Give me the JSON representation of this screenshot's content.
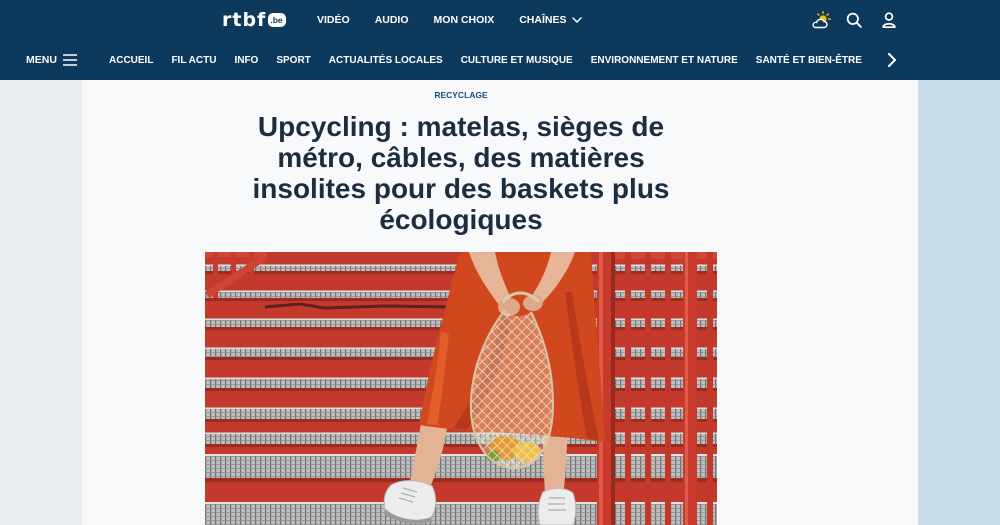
{
  "header": {
    "logo": {
      "text": "rtbf",
      "suffix": ".be"
    },
    "top_nav": [
      {
        "label": "VIDÉO"
      },
      {
        "label": "AUDIO"
      },
      {
        "label": "MON CHOIX"
      },
      {
        "label": "CHAÎNES",
        "icon": "chevron-down-icon"
      }
    ],
    "actions": [
      {
        "icon": "weather-icon"
      },
      {
        "icon": "search-icon"
      },
      {
        "icon": "user-icon"
      }
    ],
    "menu": {
      "label": "MENU",
      "icon": "hamburger-icon"
    },
    "section_nav": [
      "ACCUEIL",
      "FIL ACTU",
      "INFO",
      "SPORT",
      "ACTUALITÉS LOCALES",
      "CULTURE ET MUSIQUE",
      "ENVIRONNEMENT ET NATURE",
      "SANTÉ ET BIEN-ÊTRE"
    ],
    "section_nav_next_icon": "chevron-right-icon"
  },
  "article": {
    "category": "RECYCLAGE",
    "title": "Upcycling : matelas, sièges de métro, câbles, des matières insolites pour des baskets plus écologiques"
  },
  "colors": {
    "header_bg": "#0d3a5c",
    "header_text": "#ffffff",
    "weather_accent": "#f2c200",
    "page_left_bg": "#e9edf0",
    "content_bg": "#f8f9fb",
    "right_rail_bg": "#c9dcea",
    "category_text": "#1a4c82",
    "title_text": "#1b2d3e"
  }
}
